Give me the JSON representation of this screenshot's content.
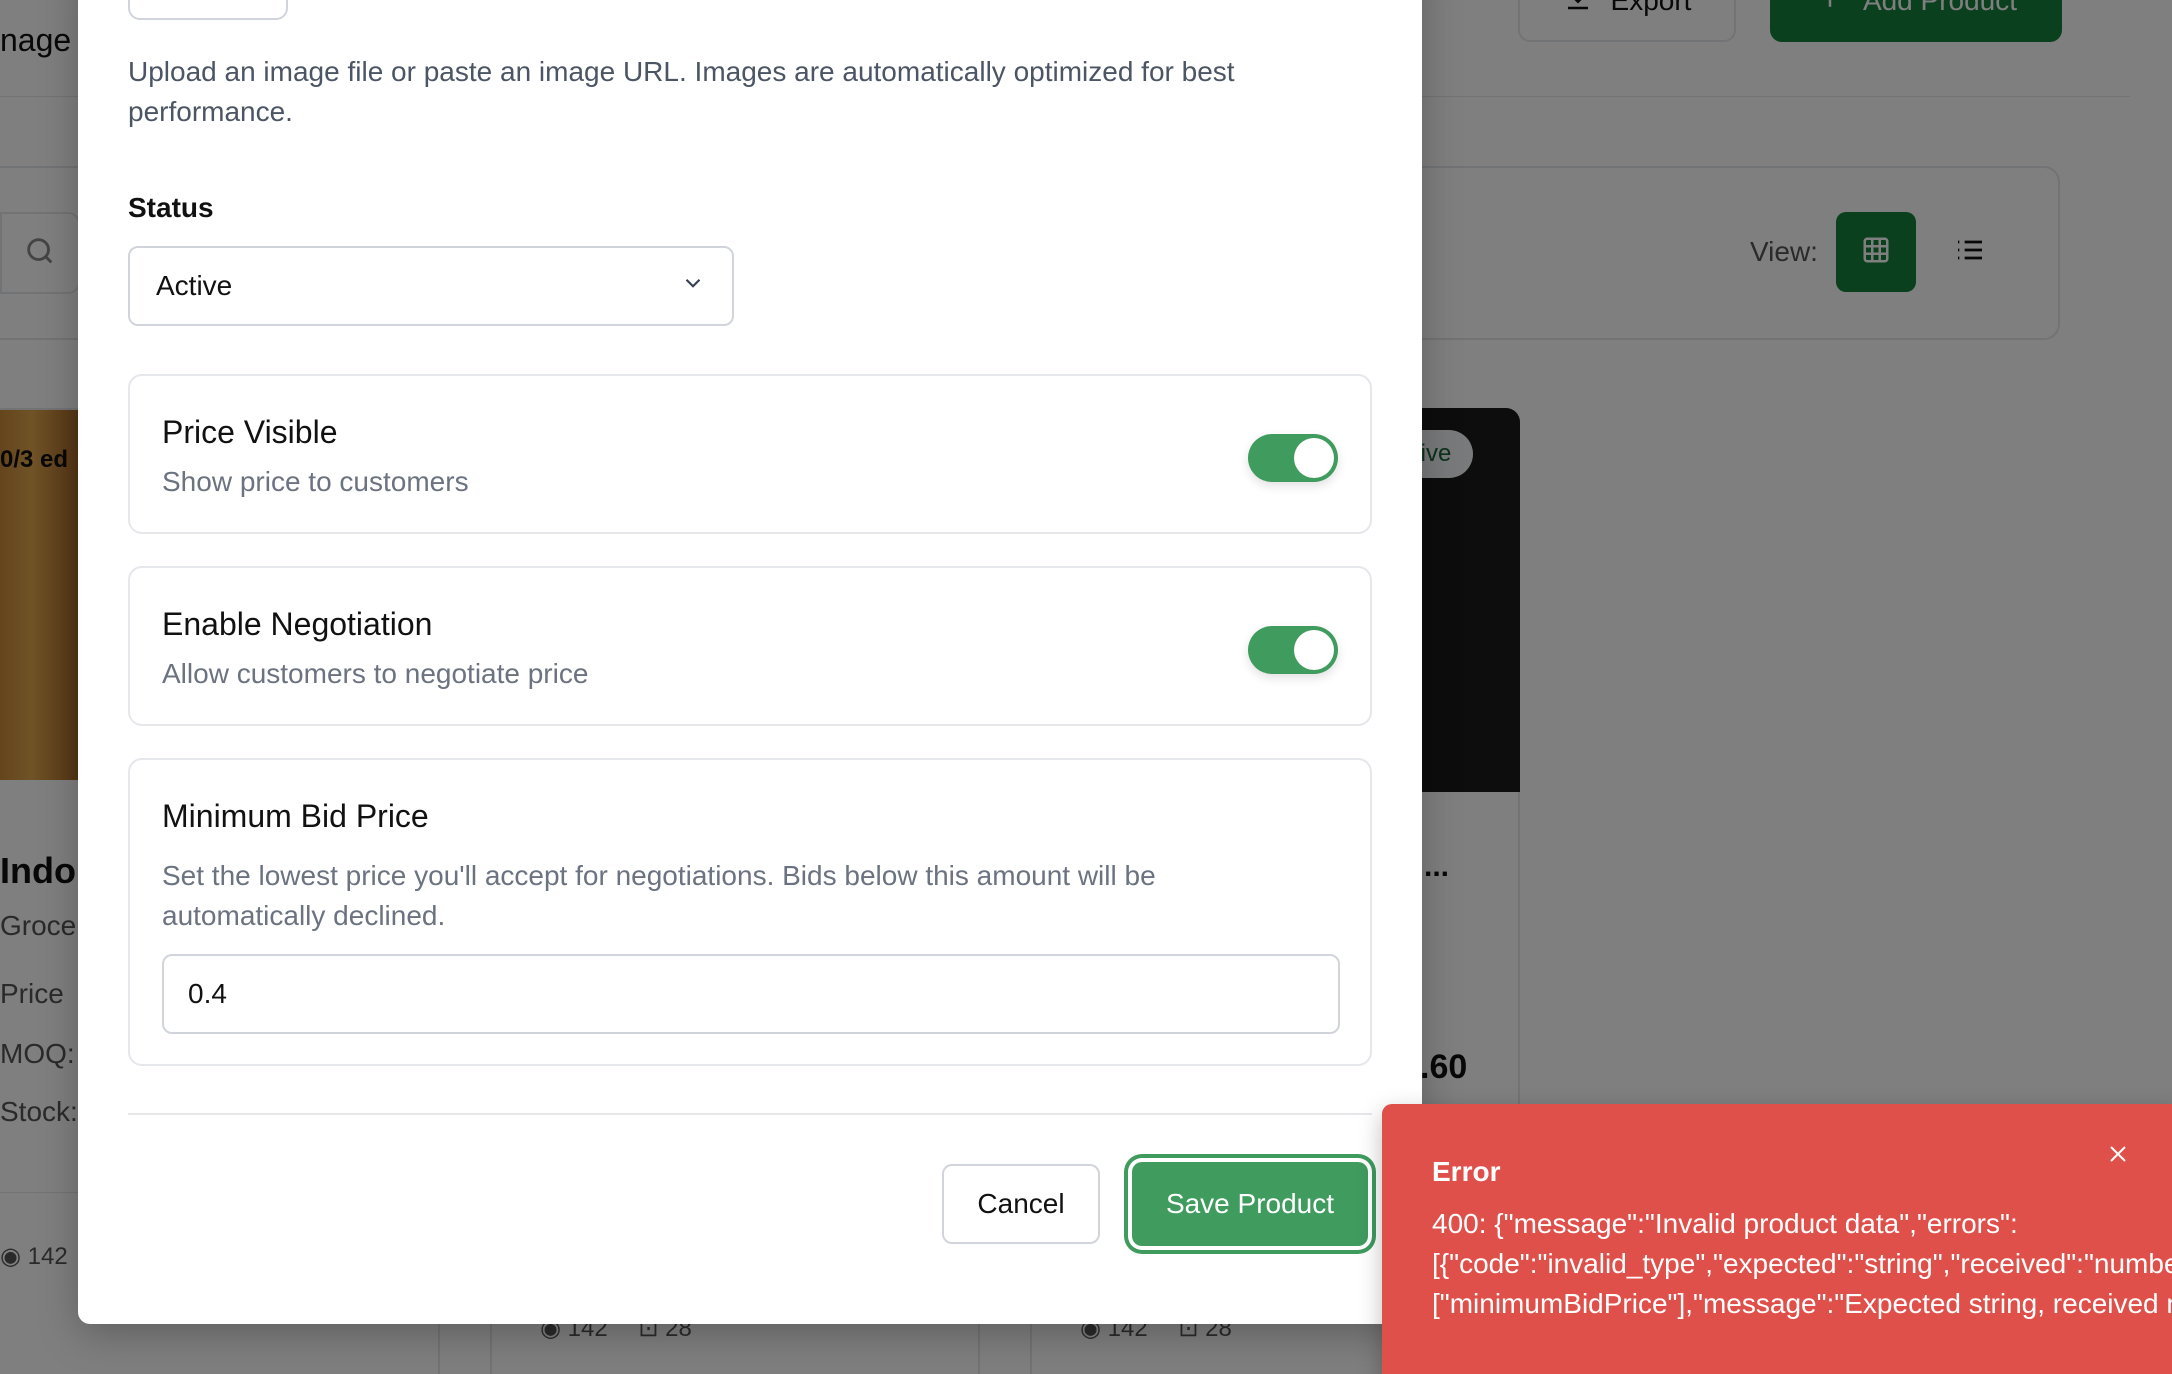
{
  "background": {
    "page_title": "nage",
    "export_label": "Export",
    "add_product_label": "Add Product",
    "view_label": "View:",
    "card1": {
      "edit_count": "0/3 ed",
      "name": "Indo",
      "category": "Groce",
      "price_label": "Price",
      "moq_label": "MOQ:",
      "stock_label": "Stock:",
      "views": "142"
    },
    "card2": {
      "views": "142",
      "cart": "28"
    },
    "card3": {
      "badge": "ctive",
      "price": ".60",
      "views": "142",
      "cart": "28",
      "more": "..."
    }
  },
  "modal": {
    "image_help": "Upload an image file or paste an image URL. Images are automatically optimized for best performance.",
    "status": {
      "label": "Status",
      "value": "Active"
    },
    "price_visible": {
      "title": "Price Visible",
      "description": "Show price to customers",
      "enabled": true
    },
    "enable_negotiation": {
      "title": "Enable Negotiation",
      "description": "Allow customers to negotiate price",
      "enabled": true
    },
    "minimum_bid": {
      "title": "Minimum Bid Price",
      "description": "Set the lowest price you'll accept for negotiations. Bids below this amount will be automatically declined.",
      "value": "0.4"
    },
    "cancel_label": "Cancel",
    "save_label": "Save Product"
  },
  "toast": {
    "title": "Error",
    "message_line1": "400: {\"message\":\"Invalid product data\",\"errors\":",
    "message_line2": "[{\"code\":\"invalid_type\",\"expected\":\"string\",\"received\":\"number\",\"path\":",
    "message_line3": "[\"minimumBidPrice\"],\"message\":\"Expected string, received number\"}]}",
    "color": "#e0504a"
  },
  "colors": {
    "accent": "#3f9b5e",
    "brand_dark": "#15803d",
    "error": "#e0504a"
  }
}
